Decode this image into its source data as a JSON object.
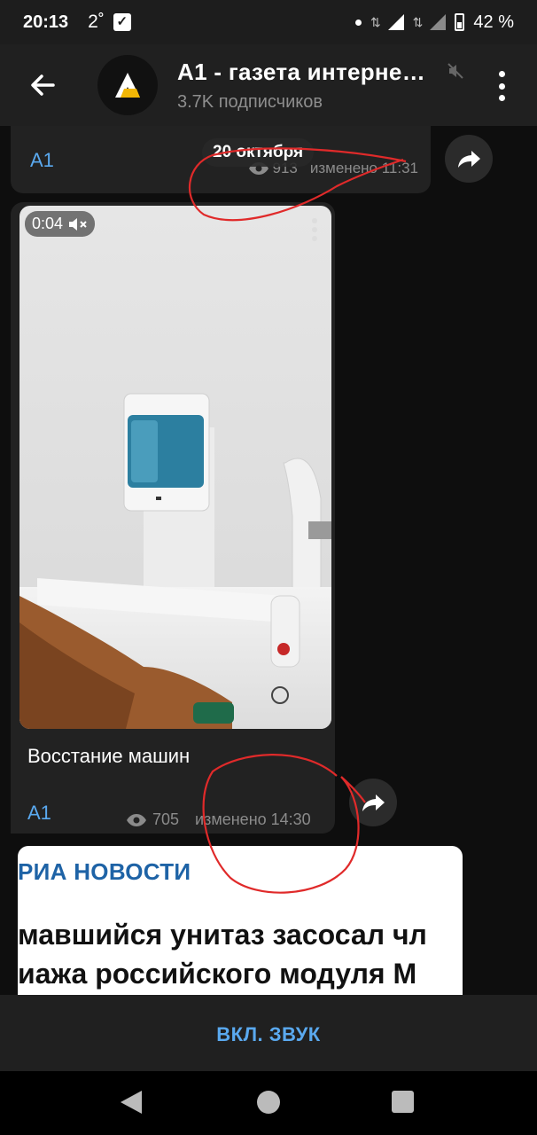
{
  "status_bar": {
    "time": "20:13",
    "temperature": "2˚",
    "battery": "42 %"
  },
  "header": {
    "title": "A1 - газета интерне…",
    "subtitle": "3.7K подписчиков"
  },
  "messages": [
    {
      "date_pill": "20 октября",
      "author": "A1",
      "views": "913",
      "edited_time": "изменено 11:31"
    },
    {
      "video_duration": "0:04",
      "caption": "Восстание машин",
      "author": "A1",
      "views": "705",
      "edited_time": "изменено 14:30"
    },
    {
      "source": "РИА НОВОСТИ",
      "headline_line1": "мавшийся унитаз засосал чл",
      "headline_line2": "иажа российского модуля М"
    }
  ],
  "bottom": {
    "sound_button": "ВКЛ. ЗВУК"
  },
  "colors": {
    "accent": "#5aa9ef",
    "ria_blue": "#1e63a6",
    "annotation_red": "#e02a2a"
  }
}
